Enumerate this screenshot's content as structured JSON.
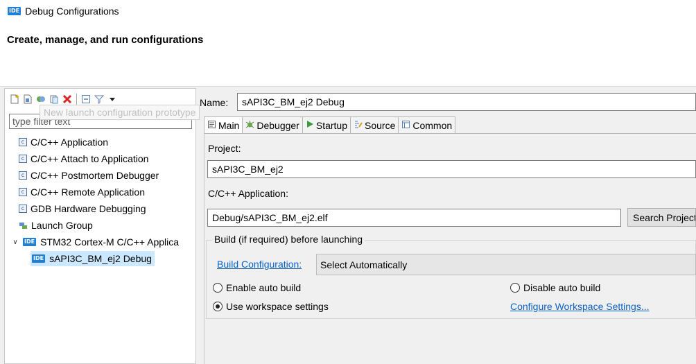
{
  "window": {
    "title": "Debug Configurations",
    "badge": "IDE"
  },
  "header": {
    "title": "Create, manage, and run configurations"
  },
  "toolbar": {
    "tooltip": "New launch configuration prototype",
    "icons": [
      "new-config-icon",
      "new-prototype-icon",
      "duplicate-icon",
      "export-icon",
      "delete-icon",
      "collapse-all-icon",
      "filter-icon",
      "view-menu-icon"
    ]
  },
  "filter": {
    "placeholder": "type filter text",
    "value": ""
  },
  "tree": {
    "items": [
      {
        "label": "C/C++ Application"
      },
      {
        "label": "C/C++ Attach to Application"
      },
      {
        "label": "C/C++ Postmortem Debugger"
      },
      {
        "label": "C/C++ Remote Application"
      },
      {
        "label": "GDB Hardware Debugging"
      },
      {
        "label": "Launch Group"
      },
      {
        "label": "STM32 Cortex-M C/C++ Applica"
      },
      {
        "label": "sAPI3C_BM_ej2 Debug"
      }
    ],
    "selected": "sAPI3C_BM_ej2 Debug"
  },
  "config": {
    "name_label": "Name:",
    "name_value": "sAPI3C_BM_ej2 Debug"
  },
  "tabs": [
    {
      "label": "Main",
      "icon": "main-tab-icon"
    },
    {
      "label": "Debugger",
      "icon": "debugger-tab-icon"
    },
    {
      "label": "Startup",
      "icon": "startup-tab-icon"
    },
    {
      "label": "Source",
      "icon": "source-tab-icon"
    },
    {
      "label": "Common",
      "icon": "common-tab-icon"
    }
  ],
  "main": {
    "project_label": "Project:",
    "project_value": "sAPI3C_BM_ej2",
    "app_label": "C/C++ Application:",
    "app_value": "Debug/sAPI3C_BM_ej2.elf",
    "search_button": "Search Project...",
    "build_group_title": "Build (if required) before launching",
    "build_config_link": "Build Configuration:",
    "build_config_value": "Select Automatically",
    "radio_enable": "Enable auto build",
    "radio_disable": "Disable auto build",
    "radio_workspace": "Use workspace settings",
    "configure_link": "Configure Workspace Settings...",
    "selected_radio": "Use workspace settings"
  },
  "colors": {
    "selection": "#cce8ff",
    "link": "#0b62c4",
    "badge": "#1f7fd6"
  }
}
